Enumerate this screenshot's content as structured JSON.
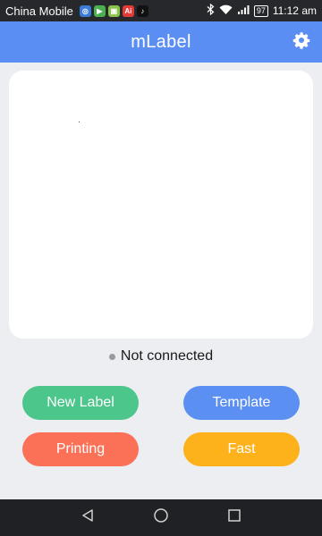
{
  "status_bar": {
    "carrier": "China Mobile",
    "notification_icons": [
      {
        "name": "app-notification-icon-1",
        "color": "#3a7bd5",
        "glyph": "◎"
      },
      {
        "name": "app-notification-icon-2",
        "color": "#4caf50",
        "glyph": "▶"
      },
      {
        "name": "app-notification-icon-3",
        "color": "#8bc34a",
        "glyph": "▣"
      },
      {
        "name": "app-notification-icon-4",
        "color": "#e53935",
        "glyph": "Ai"
      },
      {
        "name": "tiktok-icon",
        "color": "#111111",
        "glyph": "♪"
      }
    ],
    "battery": "97",
    "time": "11:12 am"
  },
  "app_bar": {
    "title": "mLabel",
    "settings_icon": "gear-icon",
    "color": "#5b8ef2"
  },
  "connection": {
    "status": "Not connected",
    "dot_color": "#9a9a9a"
  },
  "actions": [
    {
      "name": "new-label-button",
      "label": "New Label",
      "color": "#4cc68a"
    },
    {
      "name": "template-button",
      "label": "Template",
      "color": "#5c8ff2"
    },
    {
      "name": "printing-button",
      "label": "Printing",
      "color": "#fb7158"
    },
    {
      "name": "fast-button",
      "label": "Fast",
      "color": "#fdb21c"
    }
  ],
  "nav": {
    "back_icon": "back-triangle-icon",
    "home_icon": "home-circle-icon",
    "recents_icon": "recents-square-icon"
  }
}
